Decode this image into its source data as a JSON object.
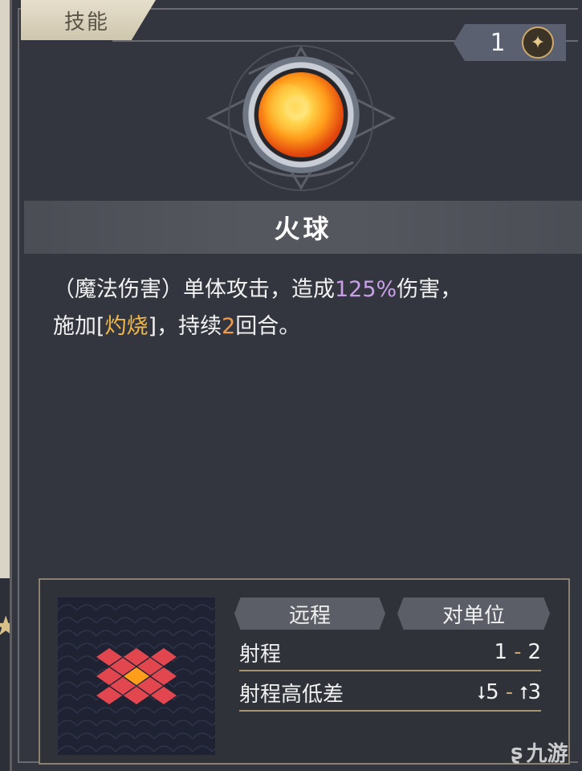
{
  "panel": {
    "tab_label": "技能",
    "counter": {
      "value": "1",
      "icon": "star-coin-icon"
    }
  },
  "skill": {
    "icon": "fireball-icon",
    "name": "火球",
    "description": {
      "part1": "（魔法伤害）单体攻击，造成",
      "damage": "125%",
      "part2": "伤害，",
      "part3": "施加[",
      "effect": "灼烧",
      "part4": "]，持续",
      "turns": "2",
      "part5": "回合。"
    }
  },
  "info": {
    "attack_type": "远程",
    "target_type": "对单位",
    "range_label": "射程",
    "range_min": "1",
    "range_max": "2",
    "height_label": "射程高低差",
    "height_down": "5",
    "height_up": "3"
  },
  "watermark": {
    "text": "九游"
  },
  "colors": {
    "highlight_damage": "#c9a0e8",
    "highlight_effect": "#f0b84a",
    "highlight_turns": "#f39a4a",
    "grid_cell": "#e2474f",
    "grid_center": "#ff9e1a"
  }
}
